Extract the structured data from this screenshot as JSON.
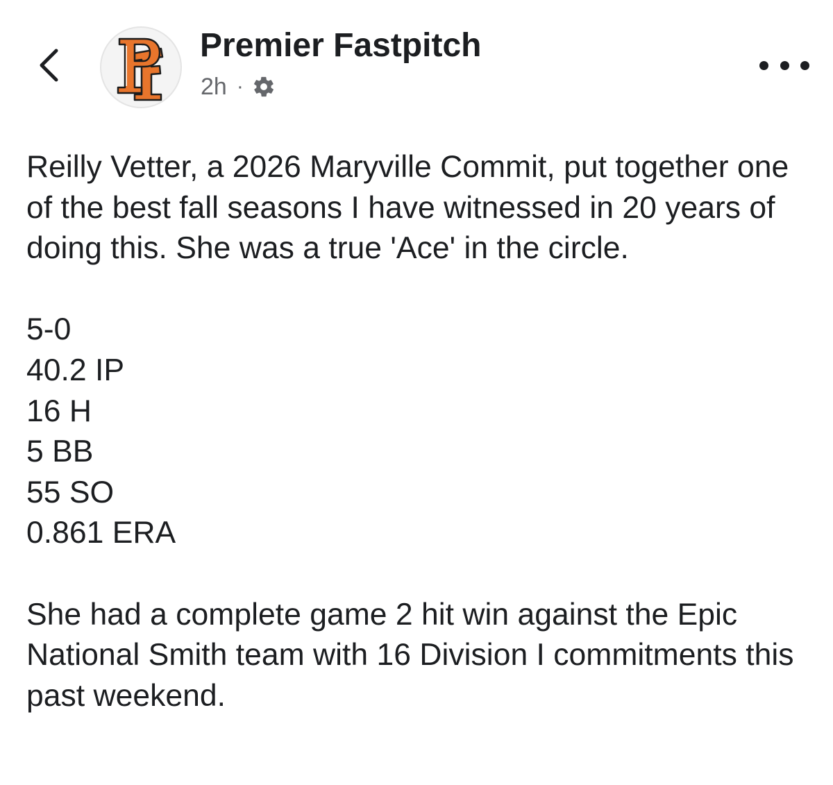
{
  "header": {
    "back_icon": "chevron-left-icon",
    "page_name": "Premier Fastpitch",
    "timestamp": "2h",
    "separator": "·",
    "audience_icon": "gear-icon",
    "more_icon": "more-horizontal-icon",
    "avatar_monogram": "PF"
  },
  "post": {
    "intro": "Reilly Vetter, a 2026 Maryville Commit, put together one of the best fall seasons I have witnessed in 20 years of doing this. She was a true 'Ace' in the circle.",
    "stats": [
      "5-0",
      "40.2 IP",
      "16 H",
      "5 BB",
      "55 SO",
      "0.861 ERA"
    ],
    "closing": "She had a complete game 2 hit win against the Epic National Smith team with 16 Division I commitments this past weekend."
  },
  "colors": {
    "text_primary": "#1c1e21",
    "text_secondary": "#65676b",
    "brand_orange": "#e8752c",
    "brand_dark": "#1c1c1c"
  }
}
